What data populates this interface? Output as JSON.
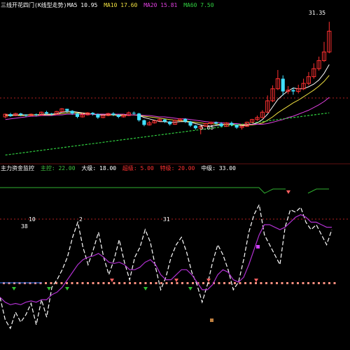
{
  "colors": {
    "background": "#000000",
    "bull": "#ff3030",
    "bear": "#40e0ff",
    "ma_white": "#ffffff",
    "ma_yellow": "#f0e040",
    "ma_magenta": "#e040e0",
    "ma_green": "#30d040",
    "grid_red": "#b02020",
    "indicator_white": "#ffffff",
    "indicator_purple": "#b030d0",
    "indicator_green": "#30b030",
    "marker_salmon": "#ff9080",
    "marker_blue": "#4080ff"
  },
  "price_panel": {
    "title": "三线开花四门(K线型走势)",
    "legend": [
      {
        "text": "MA5 10.95",
        "color": "#ffffff"
      },
      {
        "text": "MA10 17.60",
        "color": "#f0e040"
      },
      {
        "text": "MA20 15.81",
        "color": "#e040e0"
      },
      {
        "text": "MA60 7.50",
        "color": "#30d040"
      }
    ],
    "high_label": "31.35",
    "low_label": "5.65"
  },
  "chart_data": [
    {
      "type": "candlestick",
      "title": "",
      "candles": [
        [
          3.8,
          4.2,
          3.6,
          4.3
        ],
        [
          4.2,
          3.9,
          3.8,
          4.4
        ],
        [
          4.0,
          4.3,
          3.9,
          4.4
        ],
        [
          4.3,
          4.1,
          3.9,
          4.4
        ],
        [
          4.1,
          4.0,
          3.8,
          4.2
        ],
        [
          4.0,
          4.2,
          3.9,
          4.3
        ],
        [
          4.2,
          4.1,
          3.9,
          4.3
        ],
        [
          4.1,
          4.5,
          4.0,
          4.6
        ],
        [
          4.5,
          4.3,
          4.1,
          4.7
        ],
        [
          4.3,
          4.2,
          4.0,
          4.4
        ],
        [
          4.2,
          4.6,
          4.1,
          4.7
        ],
        [
          4.6,
          5.0,
          4.5,
          5.1
        ],
        [
          5.0,
          4.7,
          4.4,
          5.0
        ],
        [
          4.7,
          4.3,
          4.1,
          4.8
        ],
        [
          4.3,
          3.8,
          3.6,
          4.4
        ],
        [
          3.8,
          4.1,
          3.7,
          4.4
        ],
        [
          4.1,
          4.4,
          4.0,
          4.5
        ],
        [
          4.4,
          4.2,
          4.0,
          4.5
        ],
        [
          4.2,
          3.7,
          3.5,
          4.3
        ],
        [
          3.7,
          4.0,
          3.6,
          4.1
        ],
        [
          4.0,
          4.3,
          3.9,
          4.4
        ],
        [
          4.3,
          4.1,
          3.9,
          4.5
        ],
        [
          4.1,
          3.8,
          3.6,
          4.2
        ],
        [
          3.8,
          4.0,
          3.7,
          4.2
        ],
        [
          4.0,
          4.4,
          3.9,
          4.6
        ],
        [
          4.4,
          4.3,
          4.1,
          4.6
        ],
        [
          4.3,
          3.3,
          3.1,
          4.4
        ],
        [
          3.3,
          2.6,
          2.4,
          3.4
        ],
        [
          2.6,
          2.9,
          2.5,
          3.2
        ],
        [
          2.9,
          3.2,
          2.8,
          3.3
        ],
        [
          3.2,
          3.4,
          3.1,
          3.6
        ],
        [
          3.4,
          3.1,
          2.9,
          3.5
        ],
        [
          3.1,
          2.7,
          2.5,
          3.2
        ],
        [
          2.7,
          3.3,
          2.6,
          3.4
        ],
        [
          3.3,
          3.5,
          3.1,
          3.6
        ],
        [
          3.5,
          3.1,
          2.9,
          3.6
        ],
        [
          3.1,
          2.5,
          2.3,
          3.2
        ],
        [
          2.5,
          2.1,
          1.9,
          2.6
        ],
        [
          2.1,
          2.4,
          1.2,
          2.5
        ],
        [
          2.4,
          2.8,
          2.3,
          2.9
        ],
        [
          2.8,
          3.0,
          2.6,
          3.1
        ],
        [
          3.0,
          2.8,
          2.6,
          3.1
        ],
        [
          2.8,
          2.4,
          2.3,
          3.0
        ],
        [
          2.4,
          2.9,
          2.3,
          3.0
        ],
        [
          2.9,
          2.6,
          2.4,
          3.1
        ],
        [
          2.6,
          2.2,
          2.0,
          2.7
        ],
        [
          2.2,
          2.4,
          1.9,
          2.5
        ],
        [
          2.4,
          3.0,
          2.3,
          3.1
        ],
        [
          3.0,
          3.4,
          2.9,
          3.5
        ],
        [
          3.4,
          3.7,
          3.2,
          4.0
        ],
        [
          3.7,
          4.5,
          3.6,
          4.8
        ],
        [
          4.5,
          6.2,
          4.4,
          7.0
        ],
        [
          6.2,
          8.0,
          6.0,
          8.5
        ],
        [
          8.0,
          9.5,
          7.8,
          10.8
        ],
        [
          9.5,
          7.6,
          7.0,
          10.0
        ],
        [
          7.6,
          7.8,
          7.2,
          8.4
        ],
        [
          7.8,
          7.6,
          7.1,
          8.2
        ],
        [
          7.6,
          8.0,
          7.3,
          8.6
        ],
        [
          8.0,
          8.8,
          7.8,
          9.5
        ],
        [
          8.8,
          9.8,
          8.5,
          10.5
        ],
        [
          9.8,
          11.0,
          9.5,
          11.8
        ],
        [
          11.0,
          12.2,
          10.7,
          12.8
        ],
        [
          12.2,
          13.5,
          12.0,
          15.0
        ],
        [
          13.5,
          16.6,
          13.3,
          18.0
        ]
      ],
      "ma_series": [
        {
          "name": "MA5",
          "values": [
            4.1,
            4.1,
            4.1,
            4.1,
            4.1,
            4.1,
            4.1,
            4.2,
            4.2,
            4.2,
            4.3,
            4.5,
            4.6,
            4.6,
            4.5,
            4.4,
            4.3,
            4.2,
            4.1,
            4.1,
            4.1,
            4.1,
            4.0,
            4.0,
            4.1,
            4.1,
            4.0,
            3.7,
            3.5,
            3.3,
            3.1,
            3.1,
            3.0,
            3.0,
            3.1,
            3.1,
            3.0,
            2.8,
            2.6,
            2.4,
            2.4,
            2.5,
            2.6,
            2.7,
            2.7,
            2.6,
            2.5,
            2.5,
            2.7,
            2.9,
            3.4,
            4.2,
            5.3,
            6.4,
            7.1,
            7.7,
            8.1,
            8.0,
            8.0,
            8.3,
            8.7,
            9.3,
            10.3,
            11.6
          ]
        },
        {
          "name": "MA10",
          "values": [
            4.0,
            4.0,
            4.0,
            4.0,
            4.0,
            4.1,
            4.1,
            4.1,
            4.1,
            4.1,
            4.2,
            4.3,
            4.4,
            4.4,
            4.4,
            4.3,
            4.3,
            4.2,
            4.2,
            4.2,
            4.1,
            4.1,
            4.1,
            4.1,
            4.1,
            4.1,
            4.0,
            3.9,
            3.8,
            3.7,
            3.6,
            3.5,
            3.4,
            3.3,
            3.2,
            3.2,
            3.1,
            3.0,
            2.9,
            2.8,
            2.8,
            2.7,
            2.7,
            2.7,
            2.6,
            2.6,
            2.6,
            2.6,
            2.6,
            2.7,
            2.9,
            3.3,
            3.8,
            4.4,
            4.9,
            5.4,
            5.9,
            6.3,
            6.8,
            7.3,
            7.8,
            8.4,
            9.1,
            10.0
          ]
        },
        {
          "name": "MA20",
          "values": [
            3.4,
            3.5,
            3.6,
            3.7,
            3.8,
            3.9,
            3.9,
            4.0,
            4.0,
            4.0,
            4.1,
            4.1,
            4.2,
            4.2,
            4.2,
            4.2,
            4.2,
            4.2,
            4.2,
            4.2,
            4.2,
            4.2,
            4.2,
            4.2,
            4.1,
            4.1,
            4.1,
            4.0,
            4.0,
            3.9,
            3.8,
            3.8,
            3.7,
            3.6,
            3.5,
            3.5,
            3.4,
            3.3,
            3.2,
            3.1,
            3.0,
            3.0,
            2.9,
            2.9,
            2.8,
            2.8,
            2.7,
            2.7,
            2.7,
            2.7,
            2.7,
            2.8,
            3.0,
            3.2,
            3.4,
            3.7,
            3.9,
            4.2,
            4.5,
            4.8,
            5.2,
            5.6,
            6.1,
            6.7
          ]
        },
        {
          "name": "MA60",
          "values": [
            -1.9,
            -1.8,
            -1.7,
            -1.6,
            -1.5,
            -1.4,
            -1.3,
            -1.2,
            -1.1,
            -1.0,
            -0.9,
            -0.8,
            -0.7,
            -0.6,
            -0.5,
            -0.4,
            -0.3,
            -0.2,
            -0.1,
            0.0,
            0.1,
            0.2,
            0.3,
            0.4,
            0.5,
            0.6,
            0.7,
            0.8,
            0.9,
            1.0,
            1.1,
            1.2,
            1.3,
            1.4,
            1.5,
            1.6,
            1.7,
            1.8,
            1.9,
            2.0,
            2.1,
            2.2,
            2.3,
            2.4,
            2.5,
            2.6,
            2.7,
            2.8,
            2.9,
            3.0,
            3.1,
            3.2,
            3.3,
            3.4,
            3.5,
            3.6,
            3.7,
            3.8,
            3.9,
            4.0,
            4.1,
            4.2,
            4.3,
            4.4
          ]
        }
      ],
      "ylim": [
        -3,
        20
      ]
    },
    {
      "type": "line",
      "title": "",
      "x": [
        0,
        1,
        2,
        3,
        4,
        5,
        6,
        7,
        8,
        9,
        10,
        11,
        12,
        13,
        14,
        15,
        16,
        17,
        18,
        19,
        20,
        21,
        22,
        23,
        24,
        25,
        26,
        27,
        28,
        29,
        30,
        31,
        32,
        33,
        34,
        35,
        36,
        37,
        38,
        39,
        40,
        41,
        42,
        43,
        44,
        45,
        46,
        47,
        48,
        49,
        50,
        51,
        52,
        53,
        54,
        55,
        56,
        57,
        58,
        59,
        60,
        61,
        62,
        63,
        64
      ],
      "series": [
        {
          "name": "",
          "color": "#ffffff",
          "values": [
            30,
            12,
            5,
            18,
            10,
            16,
            25,
            8,
            28,
            14,
            38,
            44,
            52,
            62,
            78,
            90,
            70,
            56,
            68,
            82,
            62,
            48,
            60,
            76,
            58,
            44,
            62,
            70,
            84,
            74,
            54,
            36,
            46,
            62,
            72,
            78,
            66,
            50,
            40,
            26,
            40,
            58,
            72,
            64,
            52,
            36,
            42,
            60,
            82,
            96,
            104,
            80,
            72,
            64,
            56,
            86,
            100,
            98,
            102,
            90,
            84,
            88,
            80,
            72,
            84
          ]
        },
        {
          "name": "",
          "color": "#b030d0",
          "values": [
            30,
            26,
            24,
            25,
            24,
            26,
            27,
            26,
            28,
            28,
            32,
            34,
            38,
            44,
            50,
            56,
            60,
            62,
            63,
            65,
            62,
            58,
            57,
            58,
            56,
            52,
            52,
            54,
            58,
            60,
            56,
            48,
            44,
            44,
            48,
            52,
            52,
            48,
            42,
            36,
            36,
            40,
            48,
            52,
            50,
            44,
            42,
            46,
            56,
            68,
            80,
            88,
            88,
            86,
            84,
            86,
            90,
            94,
            96,
            94,
            90,
            90,
            88,
            86,
            86
          ]
        }
      ],
      "ylim": [
        -10,
        130
      ]
    }
  ],
  "indicator_panel": {
    "title": "主力资金监控",
    "legend": [
      {
        "text": "主控: 22.00",
        "color": "#40c040"
      },
      {
        "text": "大级: 18.00",
        "color": "#ffffff"
      },
      {
        "text": "超级: 5.00",
        "color": "#ff3030"
      },
      {
        "text": "特级: 20.00",
        "color": "#ff3030"
      },
      {
        "text": "中级: 33.00",
        "color": "#ffffff"
      }
    ],
    "markers": [
      {
        "text": "38",
        "color": "#ffffff"
      },
      {
        "text": "10",
        "color": "#ffffff"
      },
      {
        "text": "2",
        "color": "#ffffff"
      },
      {
        "text": "31",
        "color": "#ffffff"
      }
    ]
  }
}
